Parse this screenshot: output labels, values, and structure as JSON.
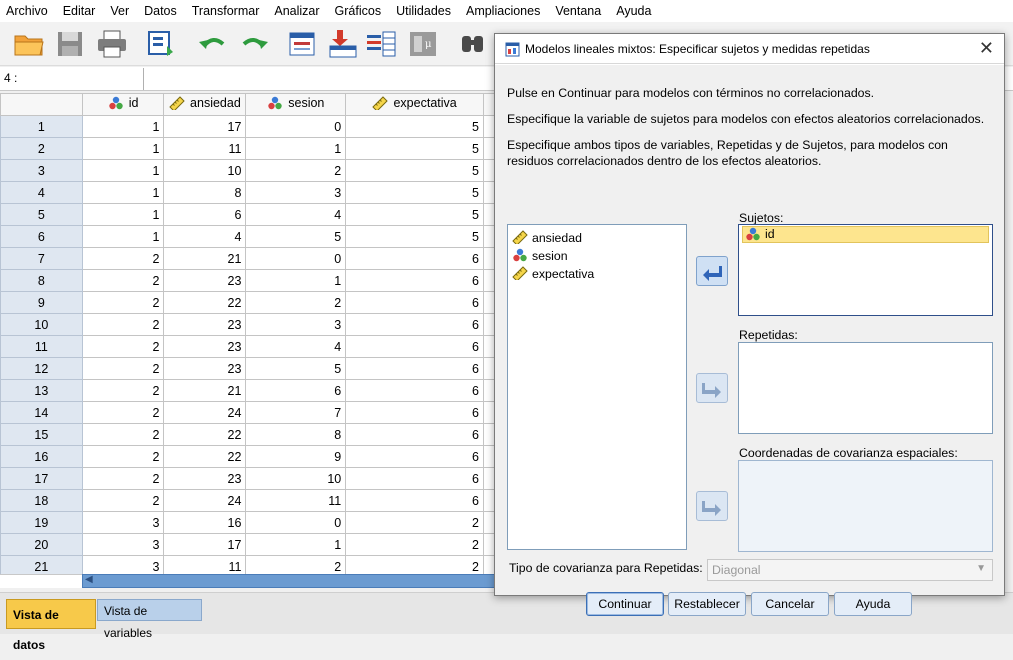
{
  "menu": [
    "Archivo",
    "Editar",
    "Ver",
    "Datos",
    "Transformar",
    "Analizar",
    "Gráficos",
    "Utilidades",
    "Ampliaciones",
    "Ventana",
    "Ayuda"
  ],
  "toolbar_icons": [
    "open-folder-icon",
    "save-icon",
    "print-icon",
    "dialog-recall-icon",
    "undo-icon",
    "redo-icon",
    "goto-case-icon",
    "goto-variable-icon",
    "variables-icon",
    "run-descriptives-icon",
    "find-icon"
  ],
  "cell_ref": "4 :",
  "grid": {
    "columns": [
      {
        "name": "id",
        "icon": "nominal-icon"
      },
      {
        "name": "ansiedad",
        "icon": "scale-icon"
      },
      {
        "name": "sesion",
        "icon": "nominal-icon"
      },
      {
        "name": "expectativa",
        "icon": "scale-icon"
      }
    ],
    "rows": [
      {
        "n": "1",
        "id": "1",
        "ansiedad": "17",
        "sesion": "0",
        "expectativa": "5"
      },
      {
        "n": "2",
        "id": "1",
        "ansiedad": "11",
        "sesion": "1",
        "expectativa": "5"
      },
      {
        "n": "3",
        "id": "1",
        "ansiedad": "10",
        "sesion": "2",
        "expectativa": "5"
      },
      {
        "n": "4",
        "id": "1",
        "ansiedad": "8",
        "sesion": "3",
        "expectativa": "5"
      },
      {
        "n": "5",
        "id": "1",
        "ansiedad": "6",
        "sesion": "4",
        "expectativa": "5"
      },
      {
        "n": "6",
        "id": "1",
        "ansiedad": "4",
        "sesion": "5",
        "expectativa": "5"
      },
      {
        "n": "7",
        "id": "2",
        "ansiedad": "21",
        "sesion": "0",
        "expectativa": "6"
      },
      {
        "n": "8",
        "id": "2",
        "ansiedad": "23",
        "sesion": "1",
        "expectativa": "6"
      },
      {
        "n": "9",
        "id": "2",
        "ansiedad": "22",
        "sesion": "2",
        "expectativa": "6"
      },
      {
        "n": "10",
        "id": "2",
        "ansiedad": "23",
        "sesion": "3",
        "expectativa": "6"
      },
      {
        "n": "11",
        "id": "2",
        "ansiedad": "23",
        "sesion": "4",
        "expectativa": "6"
      },
      {
        "n": "12",
        "id": "2",
        "ansiedad": "23",
        "sesion": "5",
        "expectativa": "6"
      },
      {
        "n": "13",
        "id": "2",
        "ansiedad": "21",
        "sesion": "6",
        "expectativa": "6"
      },
      {
        "n": "14",
        "id": "2",
        "ansiedad": "24",
        "sesion": "7",
        "expectativa": "6"
      },
      {
        "n": "15",
        "id": "2",
        "ansiedad": "22",
        "sesion": "8",
        "expectativa": "6"
      },
      {
        "n": "16",
        "id": "2",
        "ansiedad": "22",
        "sesion": "9",
        "expectativa": "6"
      },
      {
        "n": "17",
        "id": "2",
        "ansiedad": "23",
        "sesion": "10",
        "expectativa": "6"
      },
      {
        "n": "18",
        "id": "2",
        "ansiedad": "24",
        "sesion": "11",
        "expectativa": "6"
      },
      {
        "n": "19",
        "id": "3",
        "ansiedad": "16",
        "sesion": "0",
        "expectativa": "2"
      },
      {
        "n": "20",
        "id": "3",
        "ansiedad": "17",
        "sesion": "1",
        "expectativa": "2"
      },
      {
        "n": "21",
        "id": "3",
        "ansiedad": "11",
        "sesion": "2",
        "expectativa": "2"
      }
    ]
  },
  "tabs": {
    "data_view": "Vista de datos",
    "variable_view": "Vista de variables"
  },
  "dialog": {
    "title": "Modelos lineales mixtos: Especificar sujetos y medidas repetidas",
    "info1": "Pulse en Continuar para modelos con términos no correlacionados.",
    "info2": "Especifique la variable de sujetos para modelos con efectos aleatorios correlacionados.",
    "info3_line1": "Especifique ambos tipos de variables, Repetidas y de Sujetos, para modelos con",
    "info3_line2": "residuos correlacionados dentro de los efectos aleatorios.",
    "source_vars": [
      {
        "name": "ansiedad",
        "icon": "scale-icon"
      },
      {
        "name": "sesion",
        "icon": "nominal-icon"
      },
      {
        "name": "expectativa",
        "icon": "scale-icon"
      }
    ],
    "subjects_label": "Sujetos:",
    "subjects": [
      {
        "name": "id",
        "icon": "nominal-icon"
      }
    ],
    "repeated_label": "Repetidas:",
    "spatial_label": "Coordenadas de covarianza espaciales:",
    "cov_type_label": "Tipo de covarianza para Repetidas:",
    "cov_type_value": "Diagonal",
    "buttons": {
      "continue": "Continuar",
      "reset": "Restablecer",
      "cancel": "Cancelar",
      "help": "Ayuda"
    }
  },
  "colors": {
    "selected_item": "#fde58e",
    "active_tab": "#f7c94a",
    "inactive_tab": "#b9d0ea",
    "row_header": "#dfe7f1",
    "scrollbar": "#6b9bd1"
  }
}
